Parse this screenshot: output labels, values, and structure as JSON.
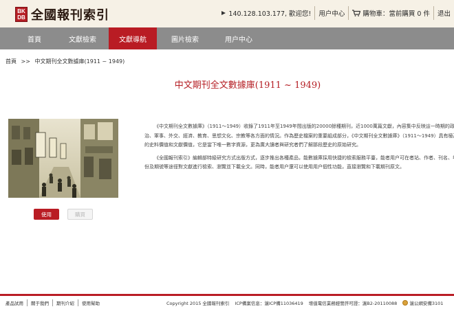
{
  "header": {
    "logo_badge_top": "BK",
    "logo_badge_bottom": "DB",
    "logo_text": "全國報刊索引",
    "ip_text": "140.128.103.177, 歡迎您!",
    "user_center": "用户中心",
    "cart_text": "購物車：當前購買 0 件",
    "logout": "退出"
  },
  "nav": {
    "items": [
      {
        "label": "首頁"
      },
      {
        "label": "文獻檢索"
      },
      {
        "label": "文獻導航"
      },
      {
        "label": "圖片檢索"
      },
      {
        "label": "用户中心"
      }
    ],
    "active": "文獻導航"
  },
  "breadcrumb": {
    "home": "首頁",
    "separator": ">>",
    "current": "中文期刊全文數據庫(1911 ~ 1949)"
  },
  "main": {
    "title": "中文期刊全文數據庫(1911 ~ 1949)",
    "use_button": "使用",
    "buy_button": "購買",
    "paragraphs": [
      "《中文期刊全文數據庫》（1911～1949）收錄了1911年至1949年間出版的20000餘種期刊，近1000萬篇文獻，內容集中反映這一時期的政治、軍事、外交、經濟、教育、思想文化、宗教等各方面的情況。作為歷史檔案的重要組成部分，《中文期刊全文數據庫》（1911～1949）具有極高的史料價值和文獻價值，它是當下唯一數字資源，更為廣大讀者與研究者們了解那段歷史的原始研究。",
      "《全國報刊索引》編輯部特級研究方式出版方式，逐步推出各種產品，能數據庫採用快捷的檢索服務平臺，能者用户可在者站、作者、刊名、年份及期號等途徑對文獻進行檢索、瀏覽並下載全文。同時，能者用户還可以使用用户個性功能，直接瀏覽和下載期刊原文。"
    ]
  },
  "footer": {
    "links": [
      "產品試用",
      "關于我們",
      "期刊介紹",
      "使用幫助"
    ],
    "copyright": "Copyright 2015 全國報刊索引",
    "icp": "ICP備案信息：滬ICP備11036419",
    "license": "增值電信業務經營許可證：滬B2-20110088",
    "police": "滬公網安備3101"
  },
  "colors": {
    "accent": "#b91c24",
    "nav_bg": "#8c8c8c",
    "header_bg": "#f6f1e6"
  }
}
